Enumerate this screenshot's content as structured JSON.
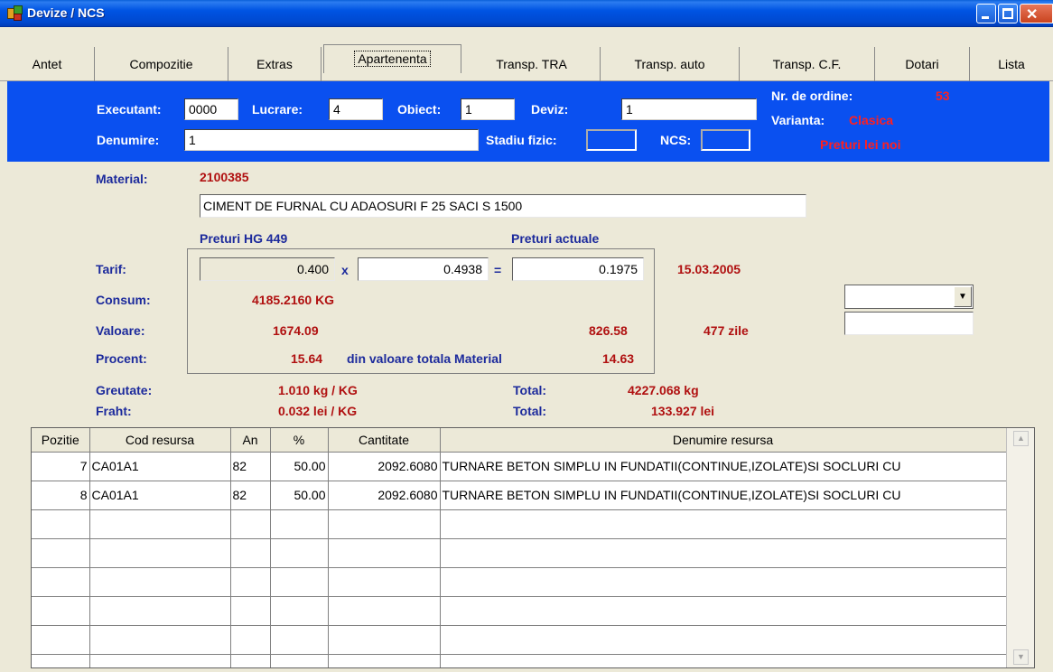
{
  "window": {
    "title": "Devize / NCS"
  },
  "tabs": [
    {
      "label": "Antet"
    },
    {
      "label": "Compozitie"
    },
    {
      "label": "Extras"
    },
    {
      "label": "Apartenenta"
    },
    {
      "label": "Transp. TRA"
    },
    {
      "label": "Transp. auto"
    },
    {
      "label": "Transp. C.F."
    },
    {
      "label": "Dotari"
    },
    {
      "label": "Lista"
    }
  ],
  "header": {
    "executant_label": "Executant:",
    "executant_value": "0000",
    "lucrare_label": "Lucrare:",
    "lucrare_value": "4",
    "obiect_label": "Obiect:",
    "obiect_value": "1",
    "deviz_label": "Deviz:",
    "deviz_value": "1",
    "denumire_label": "Denumire:",
    "denumire_value": "1",
    "stadiu_label": "Stadiu fizic:",
    "stadiu_value": "",
    "ncs_label": "NCS:",
    "ncs_value": "",
    "nr_ordine_label": "Nr. de ordine:",
    "nr_ordine_value": "53",
    "varianta_label": "Varianta:",
    "varianta_value": "Clasica",
    "preturi_note": "Preturi lei noi"
  },
  "material": {
    "label": "Material:",
    "code": "2100385",
    "name": "CIMENT DE FURNAL  CU ADAOSURI   F  25  SACI  S  1500",
    "preturi_hg_label": "Preturi HG 449",
    "preturi_actuale_label": "Preturi actuale",
    "tarif_label": "Tarif:",
    "tarif_hg": "0.400",
    "mult_sign": "x",
    "factor": "0.4938",
    "eq_sign": "=",
    "tarif_actual": "0.1975",
    "date": "15.03.2005",
    "consum_label": "Consum:",
    "consum_value": "4185.2160 KG",
    "valoare_label": "Valoare:",
    "valoare_hg": "1674.09",
    "valoare_actual": "826.58",
    "zile": "477 zile",
    "procent_label": "Procent:",
    "procent_hg": "15.64",
    "procent_text": "din valoare totala Material",
    "procent_actual": "14.63",
    "greutate_label": "Greutate:",
    "greutate_value": "1.010 kg / KG",
    "greutate_total_label": "Total:",
    "greutate_total": "4227.068 kg",
    "fraht_label": "Fraht:",
    "fraht_value": "0.032 lei / KG",
    "fraht_total_label": "Total:",
    "fraht_total": "133.927 lei",
    "combo_value": "",
    "extra_value": ""
  },
  "grid": {
    "columns": [
      "Pozitie",
      "Cod resursa",
      "An",
      "%",
      "Cantitate",
      "Denumire resursa"
    ],
    "rows": [
      {
        "pozitie": "7",
        "cod": "CA01A1",
        "an": "82",
        "procent": "50.00",
        "cantitate": "2092.6080",
        "denumire": "TURNARE BETON SIMPLU IN FUNDATII(CONTINUE,IZOLATE)SI SOCLURI CU"
      },
      {
        "pozitie": "8",
        "cod": "CA01A1",
        "an": "82",
        "procent": "50.00",
        "cantitate": "2092.6080",
        "denumire": "TURNARE BETON SIMPLU IN FUNDATII(CONTINUE,IZOLATE)SI SOCLURI CU"
      }
    ]
  }
}
